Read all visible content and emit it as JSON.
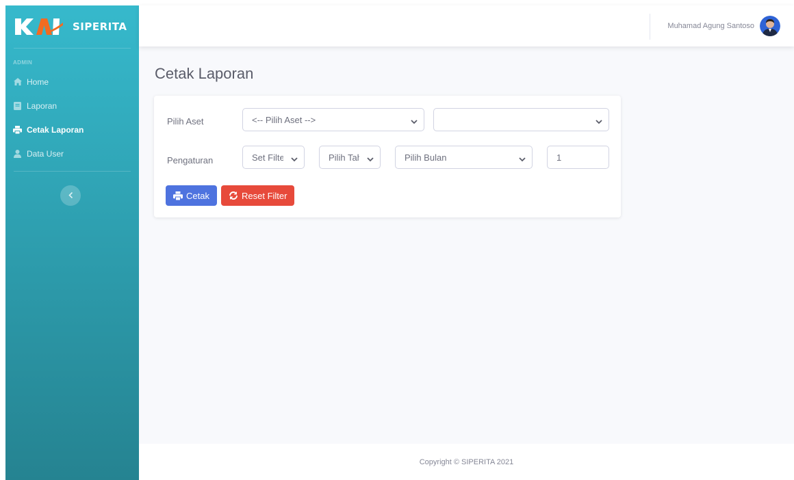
{
  "brand": {
    "name": "SIPERITA",
    "logo_text": "KAI"
  },
  "sidebar": {
    "heading": "ADMIN",
    "items": [
      {
        "label": "Home",
        "icon": "home-icon",
        "active": false
      },
      {
        "label": "Laporan",
        "icon": "book-icon",
        "active": false
      },
      {
        "label": "Cetak Laporan",
        "icon": "print-icon",
        "active": true
      },
      {
        "label": "Data User",
        "icon": "user-icon",
        "active": false
      }
    ],
    "toggle_icon": "chevron-left-icon"
  },
  "topbar": {
    "user_name": "Muhamad Agung Santoso"
  },
  "page": {
    "title": "Cetak Laporan"
  },
  "form": {
    "aset_label": "Pilih Aset",
    "aset_select": "<-- Pilih Aset -->",
    "aset_sub_select": "",
    "pengaturan_label": "Pengaturan",
    "filter_select": "Set Filter",
    "tahun_select": "Pilih Tahun",
    "bulan_select": "Pilih Bulan",
    "number_value": "1"
  },
  "buttons": {
    "print_label": "Cetak",
    "reset_label": "Reset Filter"
  },
  "footer": {
    "copyright": "Copyright © SIPERITA 2021"
  },
  "colors": {
    "sidebar_top": "#36b9cc",
    "sidebar_bottom": "#258391",
    "primary": "#4e73df",
    "danger": "#e74a3b",
    "background": "#f8f9fc"
  }
}
